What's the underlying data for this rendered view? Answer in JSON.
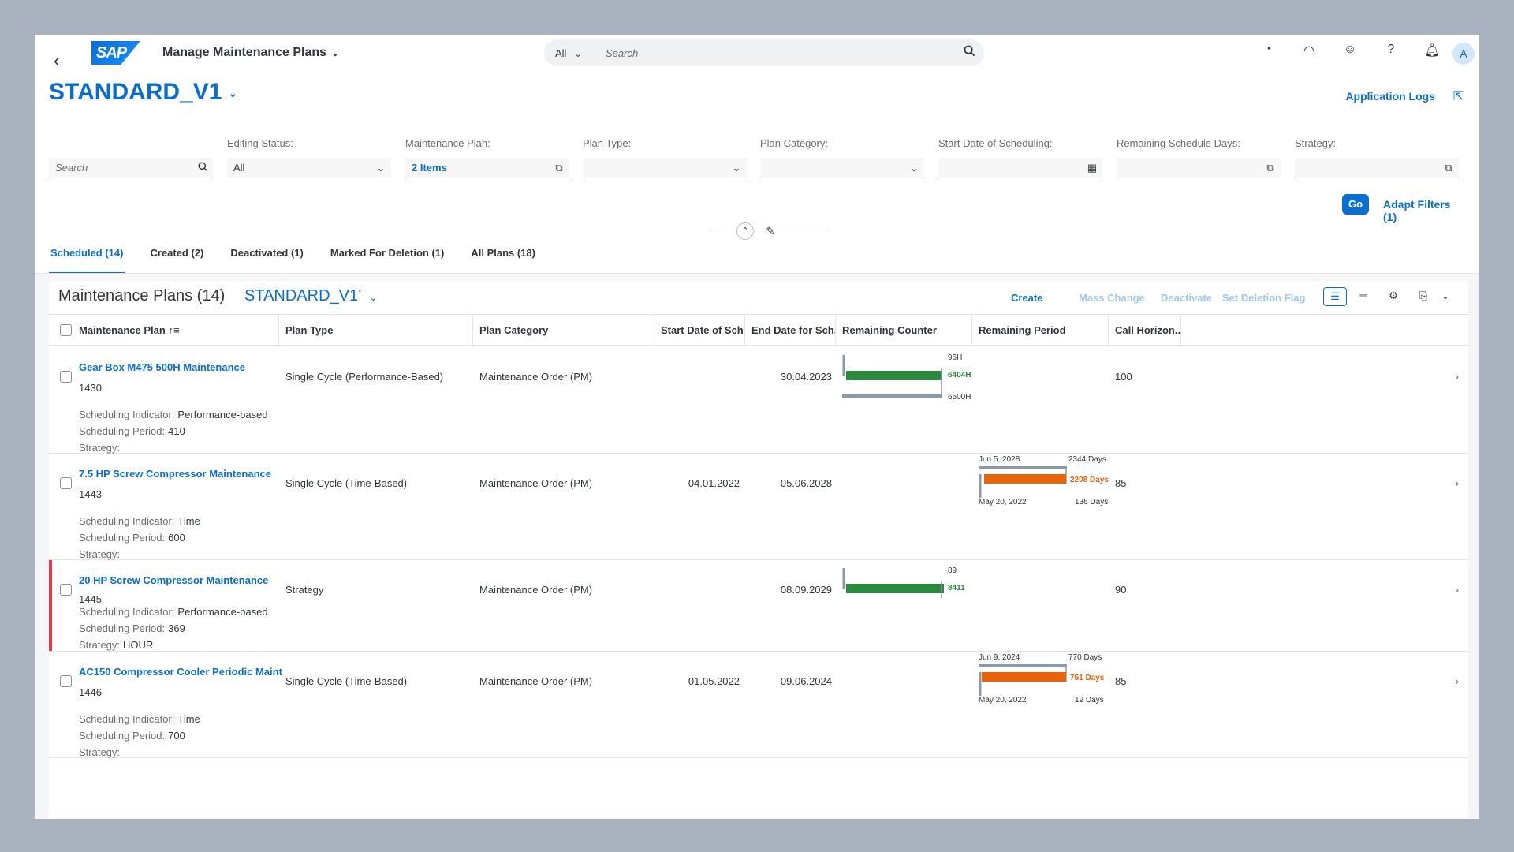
{
  "shell": {
    "back": "‹",
    "logo": "SAP",
    "app_title": "Manage Maintenance Plans",
    "search_scope": "All",
    "search_placeholder": "Search"
  },
  "header": {
    "title": "STANDARD_V1",
    "app_logs": "Application Logs"
  },
  "filters": {
    "search_placeholder": "Search",
    "items": [
      {
        "label": "Editing Status:",
        "value": "All",
        "icon": "chevron-down"
      },
      {
        "label": "Maintenance Plan:",
        "value": "2 Items",
        "icon": "value-help"
      },
      {
        "label": "Plan Type:",
        "value": "",
        "icon": "chevron-down"
      },
      {
        "label": "Plan Category:",
        "value": "",
        "icon": "chevron-down"
      },
      {
        "label": "Start Date of Scheduling:",
        "value": "",
        "icon": "calendar"
      },
      {
        "label": "Remaining Schedule Days:",
        "value": "",
        "icon": "value-help"
      },
      {
        "label": "Strategy:",
        "value": "",
        "icon": "value-help"
      }
    ],
    "go": "Go",
    "adapt": "Adapt Filters (1)"
  },
  "tabs": [
    "Scheduled (14)",
    "Created (2)",
    "Deactivated (1)",
    "Marked For Deletion (1)",
    "All Plans (18)"
  ],
  "table": {
    "title": "Maintenance Plans (14)",
    "variant": "STANDARD_V1",
    "variant_modified": "*",
    "actions": {
      "create": "Create",
      "mass_change": "Mass Change",
      "deactivate": "Deactivate",
      "set_deletion_flag": "Set Deletion Flag"
    },
    "columns": [
      "Maintenance Plan",
      "Plan Type",
      "Plan Category",
      "Start Date of Sch...",
      "End Date for Sch...",
      "Remaining Counter",
      "Remaining Period",
      "Call Horizon..."
    ],
    "detail_labels": {
      "indicator": "Scheduling Indicator:",
      "period": "Scheduling Period:",
      "strategy": "Strategy:"
    },
    "rows": [
      {
        "name": "Gear Box M475 500H Maintenance",
        "id": "1430",
        "indicator": "Performance-based",
        "period": "410",
        "strategy": "",
        "plan_type": "Single Cycle (Performance-Based)",
        "plan_category": "Maintenance Order (PM)",
        "start_date": "",
        "end_date": "30.04.2023",
        "call_horizon": "100",
        "counter": {
          "top": "96H",
          "value": "6404H",
          "bottom": "6500H",
          "fraction": 0.985
        },
        "period_bar": null
      },
      {
        "name": "7.5 HP Screw Compressor Maintenance",
        "id": "1443",
        "indicator": "Time",
        "period": "600",
        "strategy": "",
        "plan_type": "Single Cycle (Time-Based)",
        "plan_category": "Maintenance Order (PM)",
        "start_date": "04.01.2022",
        "end_date": "05.06.2028",
        "call_horizon": "85",
        "counter": null,
        "period_bar": {
          "top_left": "Jun 5, 2028",
          "top_right": "2344 Days",
          "value": "2208 Days",
          "bottom_left": "May 20, 2022",
          "bottom_right": "136 Days",
          "fraction": 0.942
        }
      },
      {
        "name": "20 HP Screw Compressor Maintenance",
        "id": "1445",
        "indicator": "Performance-based",
        "period": "369",
        "strategy": "HOUR",
        "plan_type": "Strategy",
        "plan_category": "Maintenance Order (PM)",
        "start_date": "",
        "end_date": "08.09.2029",
        "call_horizon": "90",
        "counter": {
          "top": "89",
          "value": "8411",
          "bottom": "",
          "fraction": 1.0
        },
        "period_bar": null,
        "highlight": true
      },
      {
        "name": "AC150 Compressor Cooler Periodic Maint",
        "id": "1446",
        "indicator": "Time",
        "period": "700",
        "strategy": "",
        "plan_type": "Single Cycle (Time-Based)",
        "plan_category": "Maintenance Order (PM)",
        "start_date": "01.05.2022",
        "end_date": "09.06.2024",
        "call_horizon": "85",
        "counter": null,
        "period_bar": {
          "top_left": "Jun 9, 2024",
          "top_right": "770 Days",
          "value": "751 Days",
          "bottom_left": "May 20, 2022",
          "bottom_right": "19 Days",
          "fraction": 0.975
        }
      }
    ]
  },
  "colors": {
    "accent": "#0a6ed1",
    "counter_bar": "#2b8a3e",
    "period_bar": "#e8630a",
    "track": "#8a99ab",
    "highlight": "#e63946"
  }
}
